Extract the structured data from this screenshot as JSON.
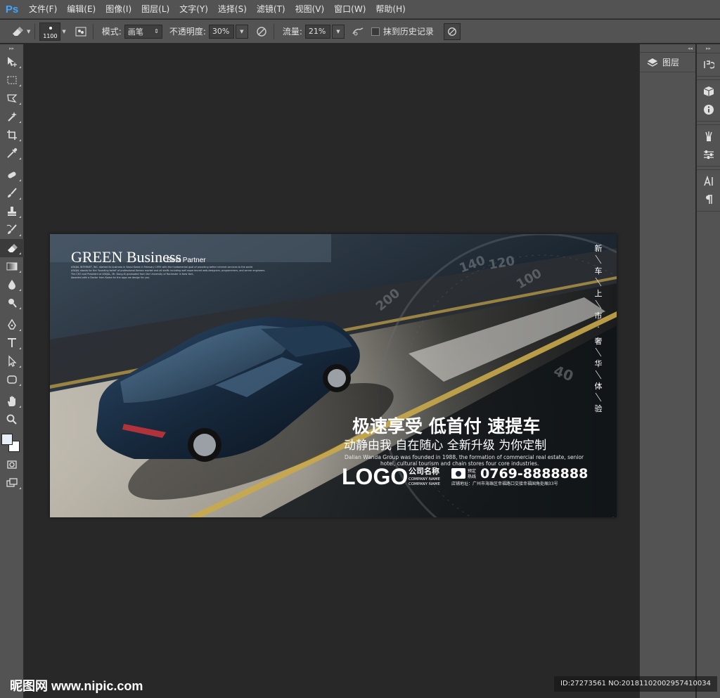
{
  "app": {
    "logo": "Ps"
  },
  "menu": [
    "文件(F)",
    "编辑(E)",
    "图像(I)",
    "图层(L)",
    "文字(Y)",
    "选择(S)",
    "滤镜(T)",
    "视图(V)",
    "窗口(W)",
    "帮助(H)"
  ],
  "options": {
    "brush_size": "1100",
    "mode_label": "模式:",
    "mode_value": "画笔",
    "opacity_label": "不透明度:",
    "opacity_value": "30%",
    "flow_label": "流量:",
    "flow_value": "21%",
    "history_label": "抹到历史记录"
  },
  "panels": {
    "layers_label": "图层"
  },
  "poster": {
    "brand_title": "GREEN Business",
    "brand_sub": "Best Partner",
    "brand_small1": "ASKJAL INTERNET, INC. started its business in Seoul Korea in February 1995 with the fundamental goal of providing better internet services to the world",
    "brand_small2": "ASKJAL stands for the 'founding belief' of professional Korean market and all staffs including well experienced web-designers, programmers, and server engineers.",
    "brand_small3": "The CEO and President of ASKJAL, Mr. Dong-Ki graduated from the University of Rochester in New York,",
    "brand_small4": "Awarded with a Doctor from Korea for the apps we design for you.",
    "vertical": [
      "新",
      "车",
      "上",
      "市",
      "·",
      "奢",
      "华",
      "体",
      "验"
    ],
    "headline": "极速享受 低首付 速提车",
    "subheadline": "动静由我 自在随心 全新升级 为你定制",
    "desc_line1": "Dalian Wanda Group was founded in 1988, the formation of commercial real estate, senior",
    "desc_line2": "hotel, cultural tourism and chain stores four core industries.",
    "logo": "LOGO",
    "company_cn": "公司名称",
    "company_en1": "COMPANY NAME",
    "company_en2": "COMPANY NAME",
    "hotline_label1": "预定",
    "hotline_label2": "热线",
    "phone": "0769-8888888",
    "address": "店铺地址：广州市海珠区幸福路口交接幸福国角处厢33号",
    "speedo": [
      "200",
      "140",
      "120",
      "100",
      "40"
    ]
  },
  "watermark": {
    "site": "昵图网 www.nipic.com",
    "id": "ID:27273561 NO:20181102002957410034"
  }
}
